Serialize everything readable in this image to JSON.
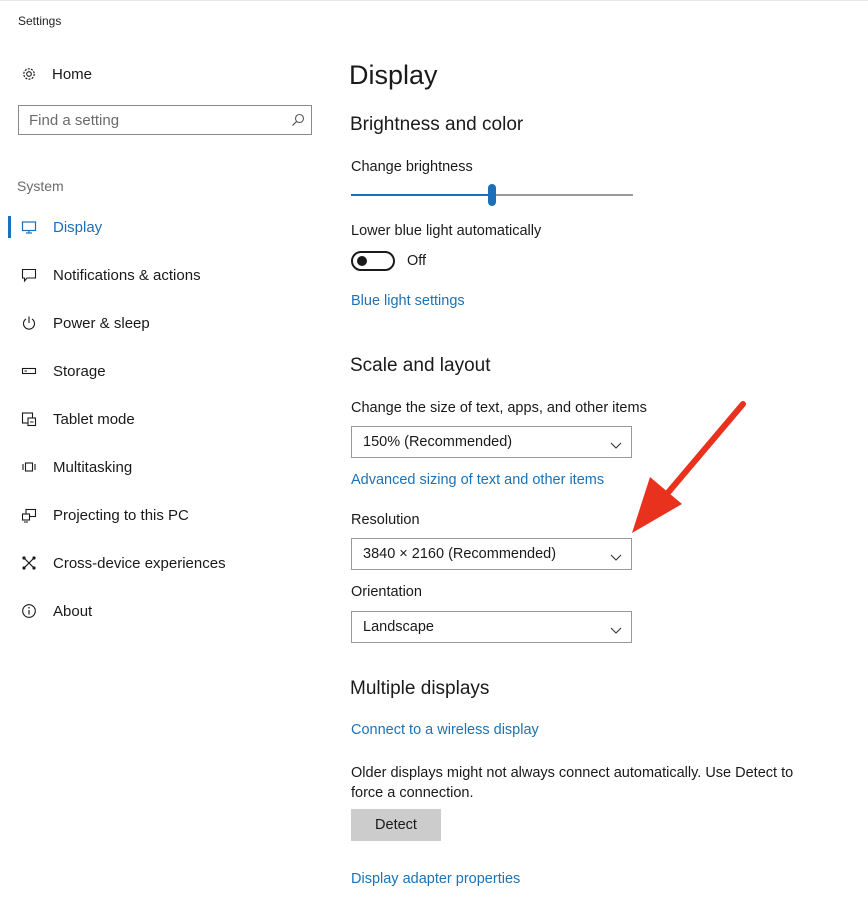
{
  "window": {
    "title": "Settings"
  },
  "sidebar": {
    "home_label": "Home",
    "search_placeholder": "Find a setting",
    "group_label": "System",
    "items": [
      {
        "label": "Display",
        "icon": "monitor-icon",
        "active": true
      },
      {
        "label": "Notifications & actions",
        "icon": "message-icon"
      },
      {
        "label": "Power & sleep",
        "icon": "power-icon"
      },
      {
        "label": "Storage",
        "icon": "storage-icon"
      },
      {
        "label": "Tablet mode",
        "icon": "tablet-mode-icon"
      },
      {
        "label": "Multitasking",
        "icon": "multitasking-icon"
      },
      {
        "label": "Projecting to this PC",
        "icon": "projecting-icon"
      },
      {
        "label": "Cross-device experiences",
        "icon": "cross-device-icon"
      },
      {
        "label": "About",
        "icon": "info-icon"
      }
    ]
  },
  "main": {
    "title": "Display",
    "brightness_section": {
      "heading": "Brightness and color",
      "brightness_label": "Change brightness",
      "brightness_value": 50,
      "night_light_label": "Lower blue light automatically",
      "night_light_state": "Off",
      "blue_light_link": "Blue light settings"
    },
    "scale_section": {
      "heading": "Scale and layout",
      "scale_label": "Change the size of text, apps, and other items",
      "scale_value": "150% (Recommended)",
      "advanced_link": "Advanced sizing of text and other items",
      "resolution_label": "Resolution",
      "resolution_value": "3840 × 2160 (Recommended)",
      "orientation_label": "Orientation",
      "orientation_value": "Landscape"
    },
    "multiple_section": {
      "heading": "Multiple displays",
      "wireless_link": "Connect to a wireless display",
      "detect_text": "Older displays might not always connect automatically. Use Detect to force a connection.",
      "detect_button": "Detect",
      "adapter_link": "Display adapter properties"
    }
  },
  "colors": {
    "accent": "#1c6fb8",
    "link": "#1b72b5",
    "annotation_arrow": "#e8321e"
  }
}
